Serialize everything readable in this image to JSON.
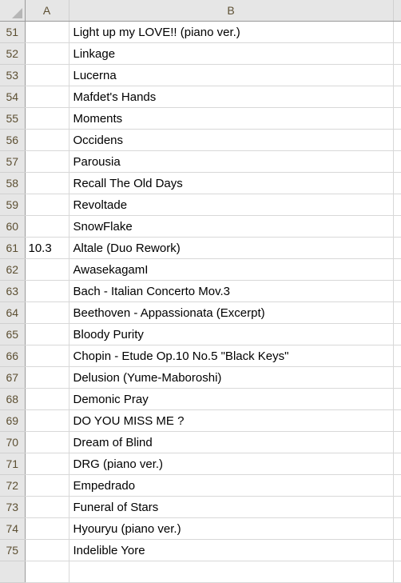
{
  "app": {
    "type": "spreadsheet",
    "select_all_icon": "select-all-triangle-icon"
  },
  "colors": {
    "header_background": "#e6e6e6",
    "header_text": "#5c4f32",
    "grid_line": "#d8d8d8",
    "header_divider": "#9a9a9a",
    "cell_background": "#ffffff",
    "cell_text": "#000000"
  },
  "columns": [
    {
      "id": "rowhdr",
      "label": ""
    },
    {
      "id": "A",
      "label": "A"
    },
    {
      "id": "B",
      "label": "B"
    },
    {
      "id": "C",
      "label": ""
    }
  ],
  "rows": [
    {
      "num": "51",
      "a": "",
      "b": "Light up my LOVE!! (piano ver.)"
    },
    {
      "num": "52",
      "a": "",
      "b": "Linkage"
    },
    {
      "num": "53",
      "a": "",
      "b": "Lucerna"
    },
    {
      "num": "54",
      "a": "",
      "b": "Mafdet's Hands"
    },
    {
      "num": "55",
      "a": "",
      "b": "Moments"
    },
    {
      "num": "56",
      "a": "",
      "b": "Occidens"
    },
    {
      "num": "57",
      "a": "",
      "b": "Parousia"
    },
    {
      "num": "58",
      "a": "",
      "b": "Recall The Old Days"
    },
    {
      "num": "59",
      "a": "",
      "b": "Revoltade"
    },
    {
      "num": "60",
      "a": "",
      "b": "SnowFlake"
    },
    {
      "num": "61",
      "a": "10.3",
      "b": "Altale (Duo Rework)"
    },
    {
      "num": "62",
      "a": "",
      "b": "AwasekagamI"
    },
    {
      "num": "63",
      "a": "",
      "b": "Bach - Italian Concerto Mov.3"
    },
    {
      "num": "64",
      "a": "",
      "b": "Beethoven - Appassionata (Excerpt)"
    },
    {
      "num": "65",
      "a": "",
      "b": "Bloody Purity"
    },
    {
      "num": "66",
      "a": "",
      "b": "Chopin - Etude Op.10 No.5 \"Black Keys\""
    },
    {
      "num": "67",
      "a": "",
      "b": "Delusion (Yume-Maboroshi)"
    },
    {
      "num": "68",
      "a": "",
      "b": "Demonic Pray"
    },
    {
      "num": "69",
      "a": "",
      "b": "DO YOU MISS ME ?"
    },
    {
      "num": "70",
      "a": "",
      "b": "Dream of Blind"
    },
    {
      "num": "71",
      "a": "",
      "b": "DRG (piano ver.)"
    },
    {
      "num": "72",
      "a": "",
      "b": "Empedrado"
    },
    {
      "num": "73",
      "a": "",
      "b": "Funeral of Stars"
    },
    {
      "num": "74",
      "a": "",
      "b": "Hyouryu (piano ver.)"
    },
    {
      "num": "75",
      "a": "",
      "b": "Indelible Yore"
    },
    {
      "num": "",
      "a": "",
      "b": ""
    }
  ]
}
